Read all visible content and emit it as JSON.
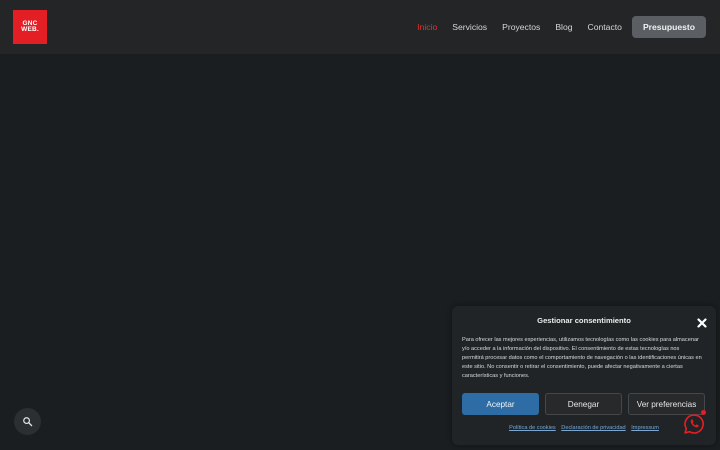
{
  "header": {
    "logo_line1": "GNC",
    "logo_line2": "WEB.",
    "nav": [
      {
        "label": "Inicio",
        "active": true
      },
      {
        "label": "Servicios"
      },
      {
        "label": "Proyectos"
      },
      {
        "label": "Blog"
      },
      {
        "label": "Contacto"
      }
    ],
    "cta_label": "Presupuesto"
  },
  "consent": {
    "title": "Gestionar consentimiento",
    "body": "Para ofrecer las mejores experiencias, utilizamos tecnologías como las cookies para almacenar y/o acceder a la información del dispositivo. El consentimiento de estas tecnologías nos permitirá procesar datos como el comportamiento de navegación o las identificaciones únicas en este sitio. No consentir o retirar el consentimiento, puede afectar negativamente a ciertas características y funciones.",
    "accept_label": "Aceptar",
    "deny_label": "Denegar",
    "prefs_label": "Ver preferencias",
    "links": [
      "Política de cookies",
      "Declaración de privacidad",
      "Impressum"
    ]
  },
  "icons": {
    "search": "search-icon",
    "close": "close-icon",
    "whatsapp": "whatsapp-icon"
  },
  "colors": {
    "brand": "#e31e24",
    "accept": "#2d6ca4",
    "active_nav": "#e5322d"
  }
}
